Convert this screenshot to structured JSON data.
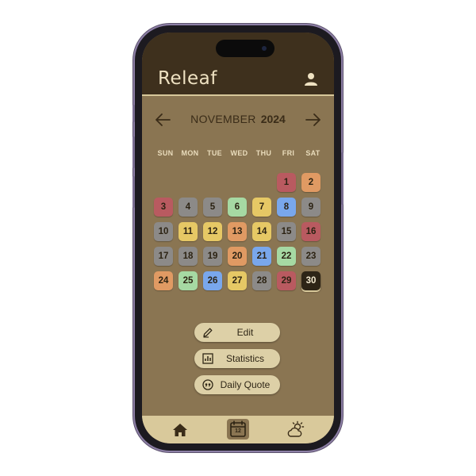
{
  "app": {
    "title": "Releaf"
  },
  "header": {
    "profile_icon": "user-icon"
  },
  "calendar": {
    "month": "NOVEMBER",
    "year": "2024",
    "weekdays": [
      "SUN",
      "MON",
      "TUE",
      "WED",
      "THU",
      "FRI",
      "SAT"
    ],
    "today": "30",
    "days": [
      {
        "label": "1",
        "color": "#b95a60"
      },
      {
        "label": "2",
        "color": "#e09a63"
      },
      {
        "label": "3",
        "color": "#b95a60"
      },
      {
        "label": "4",
        "color": "#8c8a88"
      },
      {
        "label": "5",
        "color": "#8c8a88"
      },
      {
        "label": "6",
        "color": "#a6d9a3"
      },
      {
        "label": "7",
        "color": "#e6c865"
      },
      {
        "label": "8",
        "color": "#79a7ec"
      },
      {
        "label": "9",
        "color": "#8c8a88"
      },
      {
        "label": "10",
        "color": "#8c8a88"
      },
      {
        "label": "11",
        "color": "#e6c865"
      },
      {
        "label": "12",
        "color": "#e6c865"
      },
      {
        "label": "13",
        "color": "#e09a63"
      },
      {
        "label": "14",
        "color": "#e6c865"
      },
      {
        "label": "15",
        "color": "#8c8a88"
      },
      {
        "label": "16",
        "color": "#b95a60"
      },
      {
        "label": "17",
        "color": "#8c8a88"
      },
      {
        "label": "18",
        "color": "#8c8a88"
      },
      {
        "label": "19",
        "color": "#8c8a88"
      },
      {
        "label": "20",
        "color": "#e09a63"
      },
      {
        "label": "21",
        "color": "#79a7ec"
      },
      {
        "label": "22",
        "color": "#a6d9a3"
      },
      {
        "label": "23",
        "color": "#8c8a88"
      },
      {
        "label": "24",
        "color": "#e09a63"
      },
      {
        "label": "25",
        "color": "#a6d9a3"
      },
      {
        "label": "26",
        "color": "#79a7ec"
      },
      {
        "label": "27",
        "color": "#e6c865"
      },
      {
        "label": "28",
        "color": "#8c8a88"
      },
      {
        "label": "29",
        "color": "#b95a60"
      },
      {
        "label": "30",
        "color": "#2d2416"
      }
    ],
    "prev_icon": "arrow-left-icon",
    "next_icon": "arrow-right-icon"
  },
  "actions": {
    "edit": {
      "label": "Edit",
      "icon": "pencil-icon"
    },
    "statistics": {
      "label": "Statistics",
      "icon": "chart-icon"
    },
    "daily_quote": {
      "label": "Daily Quote",
      "icon": "quote-icon"
    }
  },
  "tabbar": {
    "home": {
      "icon": "home-icon"
    },
    "calendar": {
      "icon": "calendar-icon",
      "date": "12",
      "active": true
    },
    "weather": {
      "icon": "weather-icon"
    }
  },
  "colors": {
    "header_bg": "#3e301d",
    "screen_bg": "#8a7552",
    "accent_light": "#ddd0a7",
    "text_dark": "#2f2616"
  }
}
